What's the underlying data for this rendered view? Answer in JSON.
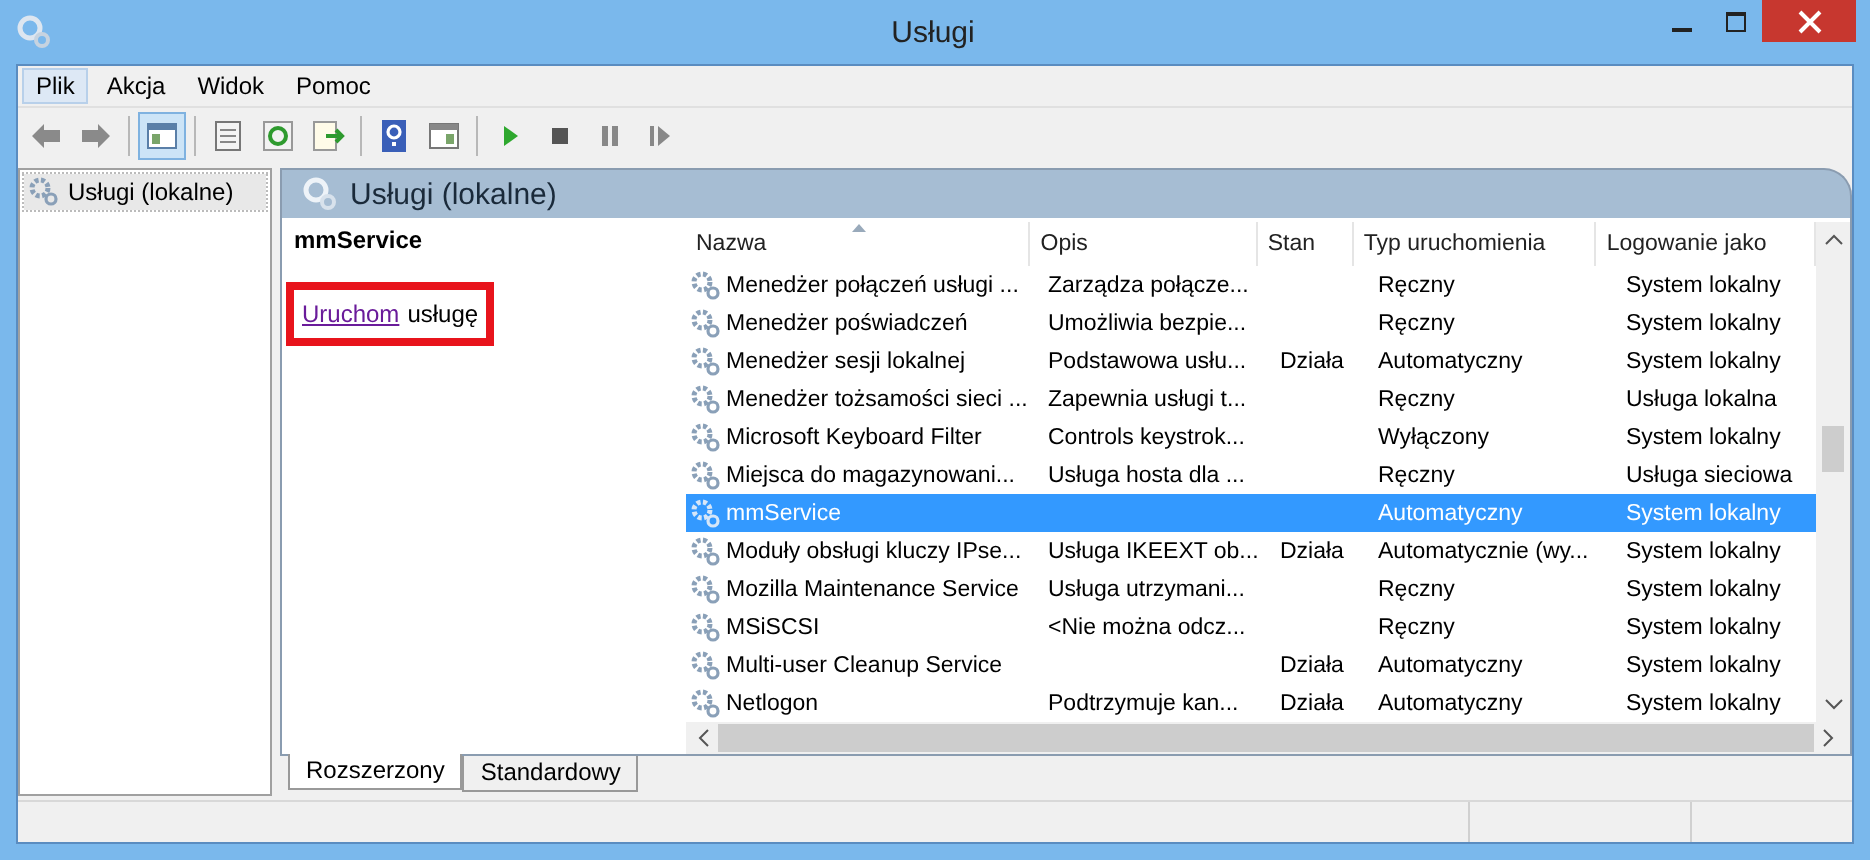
{
  "window": {
    "title": "Usługi"
  },
  "menu": [
    {
      "label": "Plik",
      "selected": true
    },
    {
      "label": "Akcja",
      "selected": false
    },
    {
      "label": "Widok",
      "selected": false
    },
    {
      "label": "Pomoc",
      "selected": false
    }
  ],
  "toolbar": [
    {
      "kind": "back",
      "selected": false
    },
    {
      "kind": "forward",
      "selected": false
    },
    {
      "kind": "separator"
    },
    {
      "kind": "tree-toggle",
      "selected": true
    },
    {
      "kind": "separator"
    },
    {
      "kind": "properties",
      "selected": false
    },
    {
      "kind": "refresh",
      "selected": false
    },
    {
      "kind": "export",
      "selected": false
    },
    {
      "kind": "separator"
    },
    {
      "kind": "help",
      "selected": false
    },
    {
      "kind": "panel",
      "selected": false
    },
    {
      "kind": "separator"
    },
    {
      "kind": "play",
      "selected": false
    },
    {
      "kind": "stop",
      "selected": false
    },
    {
      "kind": "pause",
      "selected": false
    },
    {
      "kind": "resume",
      "selected": false
    }
  ],
  "tree": {
    "items": [
      {
        "label": "Usługi (lokalne)",
        "selected": true
      }
    ]
  },
  "panel": {
    "title": "Usługi (lokalne)",
    "service_name": "mmService",
    "action_link": "Uruchom",
    "action_text": "usługę",
    "highlight_box": true
  },
  "table": {
    "columns": [
      {
        "label": "Nazwa",
        "sorted": true
      },
      {
        "label": "Opis",
        "sorted": false
      },
      {
        "label": "Stan",
        "sorted": false
      },
      {
        "label": "Typ uruchomienia",
        "sorted": false
      },
      {
        "label": "Logowanie jako",
        "sorted": false
      }
    ],
    "rows": [
      {
        "name": "Menedżer połączeń usługi ...",
        "description": "Zarządza połącze...",
        "startup": "Ręczny",
        "logon": "System lokalny",
        "selected": false
      },
      {
        "name": "Menedżer poświadczeń",
        "description": "Umożliwia bezpie...",
        "startup": "Ręczny",
        "logon": "System lokalny",
        "selected": false
      },
      {
        "name": "Menedżer sesji lokalnej",
        "description": "Podstawowa usłu...",
        "status": "Działa",
        "startup": "Automatyczny",
        "logon": "System lokalny",
        "selected": false
      },
      {
        "name": "Menedżer tożsamości sieci ...",
        "description": "Zapewnia usługi t...",
        "startup": "Ręczny",
        "logon": "Usługa lokalna",
        "selected": false
      },
      {
        "name": "Microsoft Keyboard Filter",
        "description": "Controls keystrok...",
        "startup": "Wyłączony",
        "logon": "System lokalny",
        "selected": false
      },
      {
        "name": "Miejsca do magazynowani...",
        "description": "Usługa hosta dla ...",
        "startup": "Ręczny",
        "logon": "Usługa sieciowa",
        "selected": false
      },
      {
        "name": "mmService",
        "startup": "Automatyczny",
        "logon": "System lokalny",
        "selected": true
      },
      {
        "name": "Moduły obsługi kluczy IPse...",
        "description": "Usługa IKEEXT ob...",
        "status": "Działa",
        "startup": "Automatycznie (wy...",
        "logon": "System lokalny",
        "selected": false
      },
      {
        "name": "Mozilla Maintenance Service",
        "description": "Usługa utrzymani...",
        "startup": "Ręczny",
        "logon": "System lokalny",
        "selected": false
      },
      {
        "name": "MSiSCSI",
        "description": "<Nie można odcz...",
        "startup": "Ręczny",
        "logon": "System lokalny",
        "selected": false
      },
      {
        "name": "Multi-user Cleanup Service",
        "status": "Działa",
        "startup": "Automatyczny",
        "logon": "System lokalny",
        "selected": false
      },
      {
        "name": "Netlogon",
        "description": "Podtrzymuje kan...",
        "status": "Działa",
        "startup": "Automatyczny",
        "logon": "System lokalny",
        "selected": false
      }
    ]
  },
  "view_tabs": [
    {
      "label": "Rozszerzony",
      "selected": true
    },
    {
      "label": "Standardowy",
      "selected": false
    }
  ]
}
